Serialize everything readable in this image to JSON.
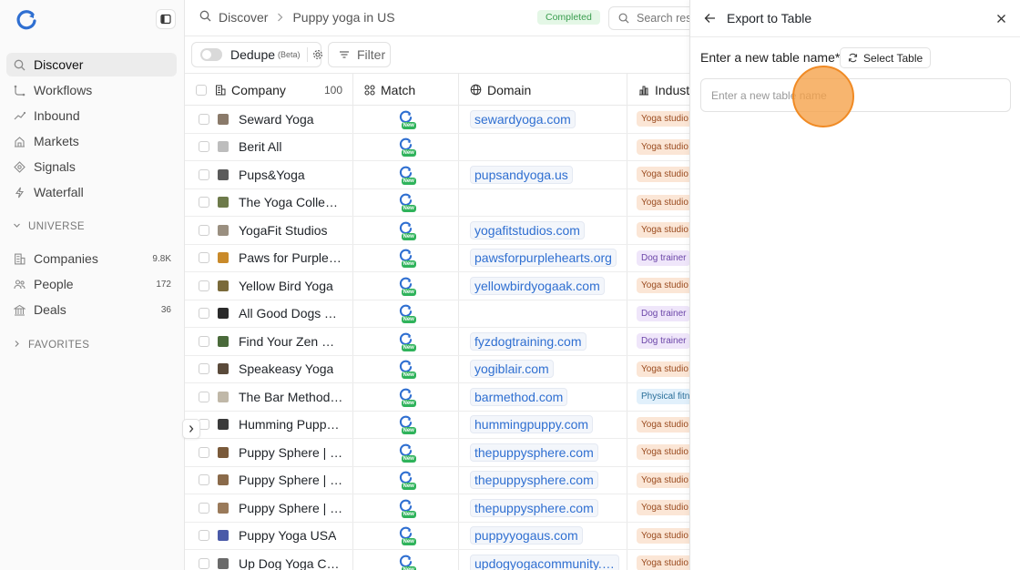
{
  "sidebar": {
    "nav": [
      {
        "label": "Discover",
        "icon": "search-icon",
        "active": true
      },
      {
        "label": "Workflows",
        "icon": "workflow-icon"
      },
      {
        "label": "Inbound",
        "icon": "inbound-icon"
      },
      {
        "label": "Markets",
        "icon": "markets-icon"
      },
      {
        "label": "Signals",
        "icon": "signals-icon"
      },
      {
        "label": "Waterfall",
        "icon": "waterfall-icon"
      }
    ],
    "universe_label": "UNIVERSE",
    "universe": [
      {
        "label": "Companies",
        "count": "9.8K",
        "icon": "building-icon"
      },
      {
        "label": "People",
        "count": "172",
        "icon": "people-icon"
      },
      {
        "label": "Deals",
        "count": "36",
        "icon": "deals-icon"
      }
    ],
    "favorites_label": "FAVORITES"
  },
  "header": {
    "crumb_root": "Discover",
    "crumb_current": "Puppy yoga in US",
    "status": "Completed",
    "search_placeholder": "Search results"
  },
  "toolbar": {
    "dedupe_label": "Dedupe",
    "beta_label": "(Beta)",
    "filter_label": "Filter"
  },
  "table": {
    "columns": {
      "company": "Company",
      "company_count": "100",
      "match": "Match",
      "domain": "Domain",
      "industry": "Industry"
    },
    "match_badge": "New",
    "rows": [
      {
        "company": "Seward Yoga",
        "domain": "sewardyoga.com",
        "industry": "Yoga studio",
        "logo": "#8a7a6a"
      },
      {
        "company": "Berit All",
        "domain": "",
        "industry": "Yoga studio",
        "logo": "#bdbdbd"
      },
      {
        "company": "Pups&Yoga",
        "domain": "pupsandyoga.us",
        "industry": "Yoga studio",
        "logo": "#5a5a5a"
      },
      {
        "company": "The Yoga Collective",
        "domain": "",
        "industry": "Yoga studio",
        "logo": "#6d7a4a"
      },
      {
        "company": "YogaFit Studios",
        "domain": "yogafitstudios.com",
        "industry": "Yoga studio",
        "logo": "#9a8f80"
      },
      {
        "company": "Paws for Purple Hearts",
        "domain": "pawsforpurplehearts.org",
        "industry": "Dog trainer",
        "logo": "#c98a2a"
      },
      {
        "company": "Yellow Bird Yoga",
        "domain": "yellowbirdyogaak.com",
        "industry": "Yoga studio",
        "logo": "#7a6a3a"
      },
      {
        "company": "All Good Dogs Training",
        "domain": "",
        "industry": "Dog trainer",
        "logo": "#2a2a2a"
      },
      {
        "company": "Find Your Zen Dog Training",
        "domain": "fyzdogtraining.com",
        "industry": "Dog trainer",
        "logo": "#4a6a3a"
      },
      {
        "company": "Speakeasy Yoga",
        "domain": "yogiblair.com",
        "industry": "Yoga studio",
        "logo": "#5a4a3a"
      },
      {
        "company": "The Bar Method Studio",
        "domain": "barmethod.com",
        "industry": "Physical fitness",
        "logo": "#c0b8a8"
      },
      {
        "company": "Humming Puppy Yoga",
        "domain": "hummingpuppy.com",
        "industry": "Yoga studio",
        "logo": "#3a3a3a"
      },
      {
        "company": "Puppy Sphere | Puppy Yoga",
        "domain": "thepuppysphere.com",
        "industry": "Yoga studio",
        "logo": "#7a5a3a"
      },
      {
        "company": "Puppy Sphere | Puppy Yoga",
        "domain": "thepuppysphere.com",
        "industry": "Yoga studio",
        "logo": "#8a6a4a"
      },
      {
        "company": "Puppy Sphere | Puppy Yoga",
        "domain": "thepuppysphere.com",
        "industry": "Yoga studio",
        "logo": "#9a7a5a"
      },
      {
        "company": "Puppy Yoga USA",
        "domain": "puppyyogaus.com",
        "industry": "Yoga studio",
        "logo": "#4a5aa8"
      },
      {
        "company": "Up Dog Yoga Community",
        "domain": "updogyogacommunity.com",
        "industry": "Yoga studio",
        "logo": "#6a6a6a"
      }
    ]
  },
  "export_panel": {
    "title": "Export to Table",
    "label": "Enter a new table name*",
    "select_table": "Select Table",
    "input_placeholder": "Enter a new table name",
    "input_value": ""
  },
  "colors": {
    "accent": "#2f6fd1",
    "completed_bg": "#e4f7e6",
    "completed_fg": "#3a9d4f",
    "yoga_bg": "#fbe6d6",
    "yoga_fg": "#9a4b1f",
    "dog_bg": "#efe6fa",
    "dog_fg": "#6b45a8",
    "fitness_bg": "#e1f0fb",
    "fitness_fg": "#2a6f9a"
  }
}
